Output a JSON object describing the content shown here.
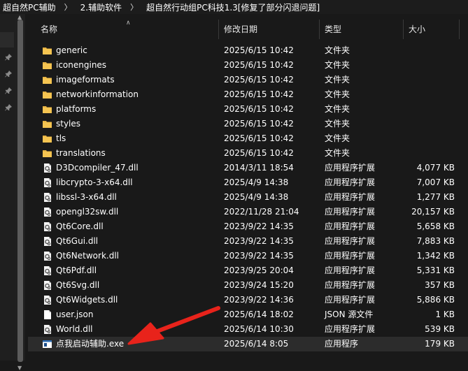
{
  "breadcrumb": [
    "超自然PC辅助",
    "2.辅助软件",
    "超自然行动组PC科技1.3[修复了部分闪退问题]"
  ],
  "breadcrumb_separator": "〉",
  "columns": {
    "name": "名称",
    "date": "修改日期",
    "type": "类型",
    "size": "大小"
  },
  "files": [
    {
      "name": "generic",
      "date": "2025/6/15 10:42",
      "type": "文件夹",
      "size": "",
      "icon": "folder-icon"
    },
    {
      "name": "iconengines",
      "date": "2025/6/15 10:42",
      "type": "文件夹",
      "size": "",
      "icon": "folder-icon"
    },
    {
      "name": "imageformats",
      "date": "2025/6/15 10:42",
      "type": "文件夹",
      "size": "",
      "icon": "folder-icon"
    },
    {
      "name": "networkinformation",
      "date": "2025/6/15 10:42",
      "type": "文件夹",
      "size": "",
      "icon": "folder-icon"
    },
    {
      "name": "platforms",
      "date": "2025/6/15 10:42",
      "type": "文件夹",
      "size": "",
      "icon": "folder-icon"
    },
    {
      "name": "styles",
      "date": "2025/6/15 10:42",
      "type": "文件夹",
      "size": "",
      "icon": "folder-icon"
    },
    {
      "name": "tls",
      "date": "2025/6/15 10:42",
      "type": "文件夹",
      "size": "",
      "icon": "folder-icon"
    },
    {
      "name": "translations",
      "date": "2025/6/15 10:42",
      "type": "文件夹",
      "size": "",
      "icon": "folder-icon"
    },
    {
      "name": "D3Dcompiler_47.dll",
      "date": "2014/3/11 18:54",
      "type": "应用程序扩展",
      "size": "4,077 KB",
      "icon": "dll-icon"
    },
    {
      "name": "libcrypto-3-x64.dll",
      "date": "2025/4/9 14:38",
      "type": "应用程序扩展",
      "size": "7,007 KB",
      "icon": "dll-icon"
    },
    {
      "name": "libssl-3-x64.dll",
      "date": "2025/4/9 14:38",
      "type": "应用程序扩展",
      "size": "1,277 KB",
      "icon": "dll-icon"
    },
    {
      "name": "opengl32sw.dll",
      "date": "2022/11/28 21:04",
      "type": "应用程序扩展",
      "size": "20,157 KB",
      "icon": "dll-icon"
    },
    {
      "name": "Qt6Core.dll",
      "date": "2023/9/22 14:35",
      "type": "应用程序扩展",
      "size": "5,658 KB",
      "icon": "dll-icon"
    },
    {
      "name": "Qt6Gui.dll",
      "date": "2023/9/22 14:35",
      "type": "应用程序扩展",
      "size": "7,883 KB",
      "icon": "dll-icon"
    },
    {
      "name": "Qt6Network.dll",
      "date": "2023/9/22 14:35",
      "type": "应用程序扩展",
      "size": "1,342 KB",
      "icon": "dll-icon"
    },
    {
      "name": "Qt6Pdf.dll",
      "date": "2023/9/25 20:04",
      "type": "应用程序扩展",
      "size": "5,331 KB",
      "icon": "dll-icon"
    },
    {
      "name": "Qt6Svg.dll",
      "date": "2023/9/24 15:20",
      "type": "应用程序扩展",
      "size": "357 KB",
      "icon": "dll-icon"
    },
    {
      "name": "Qt6Widgets.dll",
      "date": "2023/9/22 14:36",
      "type": "应用程序扩展",
      "size": "5,886 KB",
      "icon": "dll-icon"
    },
    {
      "name": "user.json",
      "date": "2025/6/14 18:02",
      "type": "JSON 源文件",
      "size": "1 KB",
      "icon": "json-file-icon"
    },
    {
      "name": "World.dll",
      "date": "2025/6/14 10:30",
      "type": "应用程序扩展",
      "size": "539 KB",
      "icon": "dll-icon"
    },
    {
      "name": "点我启动辅助.exe",
      "date": "2025/6/14 8:05",
      "type": "应用程序",
      "size": "179 KB",
      "icon": "exe-icon",
      "selected": true
    }
  ],
  "colors": {
    "background": "#191919",
    "selected_row": "#2c2c2c",
    "folder": "#e8b343",
    "annotation_arrow": "#e8231b"
  }
}
